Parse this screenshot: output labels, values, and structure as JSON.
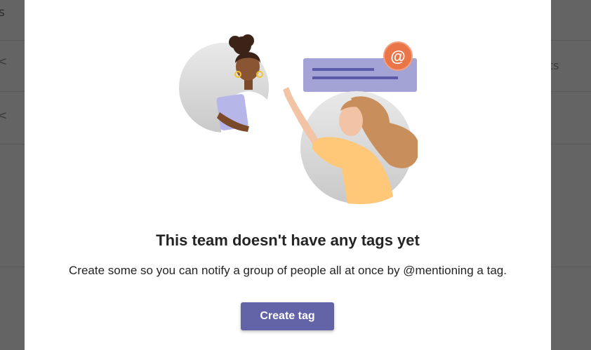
{
  "background": {
    "fragment_left": "s",
    "fragment_right": "ts",
    "fragment_left2": "<",
    "fragment_left3": "<"
  },
  "dialog": {
    "illustration_icon": "people-mention-illustration",
    "mention_symbol": "@",
    "title": "This team doesn't have any tags yet",
    "description": "Create some so you can notify a group of people all at once by @mentioning a tag.",
    "create_button_label": "Create tag"
  },
  "colors": {
    "accent": "#6264a7",
    "mention_badge": "#e97548",
    "overlay": "#646464"
  }
}
